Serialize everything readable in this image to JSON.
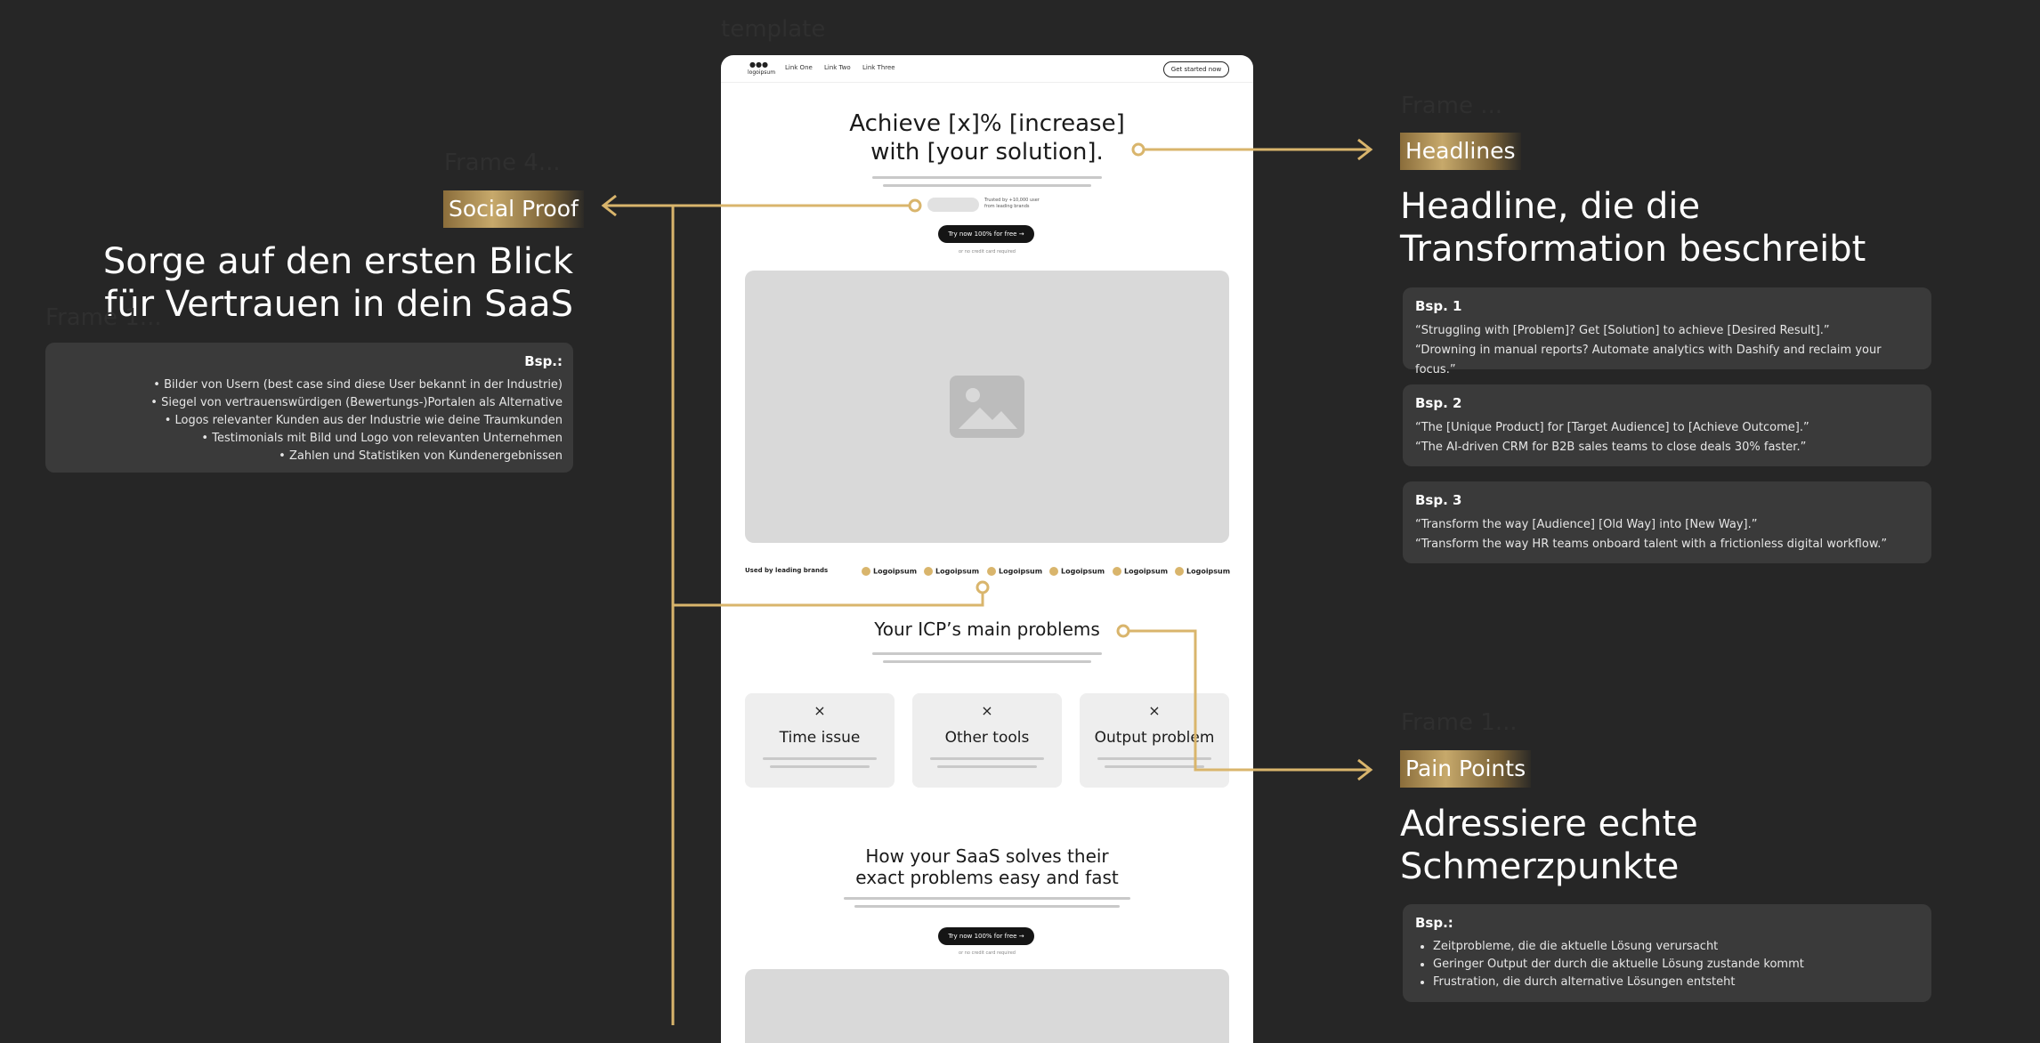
{
  "canvas_label": "template",
  "frames": {
    "headlines": "Frame ...",
    "social_proof": "Frame 4...",
    "social_proof_box": "Frame 1...",
    "pain_points": "Frame 1..."
  },
  "mockup": {
    "nav": {
      "logo": "logoipsum",
      "links": [
        "Link One",
        "Link Two",
        "Link Three"
      ],
      "cta": "Get started now"
    },
    "hero": {
      "headline_line1": "Achieve [x]% [increase]",
      "headline_line2": "with [your solution].",
      "trust_text_line1": "Trusted by +10,000 user",
      "trust_text_line2": "from leading brands",
      "cta": "Try now 100% for free",
      "note": "or no credit card required"
    },
    "brands": {
      "label": "Used by leading brands",
      "logos": [
        "Logoipsum",
        "Logoipsum",
        "Logoipsum",
        "Logoipsum",
        "Logoipsum",
        "Logoipsum"
      ]
    },
    "problems": {
      "title": "Your ICP’s main problems",
      "cards": [
        {
          "icon": "×",
          "title": "Time issue"
        },
        {
          "icon": "×",
          "title": "Other tools"
        },
        {
          "icon": "×",
          "title": "Output problem"
        }
      ]
    },
    "solution": {
      "title_line1": "How your SaaS solves their",
      "title_line2": "exact problems easy and fast",
      "cta": "Try now 100% for free",
      "note": "or no credit card required"
    }
  },
  "headlines": {
    "tag": "Headlines",
    "heading_line1": "Headline, die die",
    "heading_line2": "Transformation beschreibt",
    "examples": [
      {
        "title": "Bsp. 1",
        "lines": [
          "“Struggling with [Problem]? Get [Solution] to achieve [Desired Result].”",
          "“Drowning in manual reports? Automate analytics with Dashify and reclaim your focus.”"
        ]
      },
      {
        "title": "Bsp. 2",
        "lines": [
          "“The [Unique Product] for [Target Audience] to [Achieve Outcome].”",
          "“The AI-driven CRM for B2B sales teams to close deals 30% faster.”"
        ]
      },
      {
        "title": "Bsp. 3",
        "lines": [
          "“Transform the way [Audience] [Old Way] into [New Way].”",
          "“Transform the way HR teams onboard talent with a frictionless digital workflow.”"
        ]
      }
    ]
  },
  "social_proof": {
    "tag": "Social Proof",
    "heading_line1": "Sorge auf den ersten Blick",
    "heading_line2": "für Vertrauen in dein SaaS",
    "box_title": "Bsp.:",
    "items": [
      "Bilder von Usern (best case sind diese User bekannt in der Industrie)",
      "Siegel von vertrauenswürdigen (Bewertungs-)Portalen als Alternative",
      "Logos relevanter Kunden aus der Industrie wie deine Traumkunden",
      "Testimonials mit Bild und Logo von relevanten Unternehmen",
      "Zahlen und Statistiken von Kundenergebnissen"
    ]
  },
  "pain_points": {
    "tag": "Pain Points",
    "heading_line1": "Adressiere echte",
    "heading_line2": "Schmerzpunkte",
    "box_title": "Bsp.:",
    "items": [
      "Zeitprobleme, die die aktuelle Lösung verursacht",
      "Geringer Output der durch die aktuelle Lösung zustande kommt",
      "Frustration, die durch alternative Lösungen entsteht"
    ]
  },
  "colors": {
    "background": "#262626",
    "accent_gold": "#d9b56c",
    "box": "#3a3a3a"
  }
}
